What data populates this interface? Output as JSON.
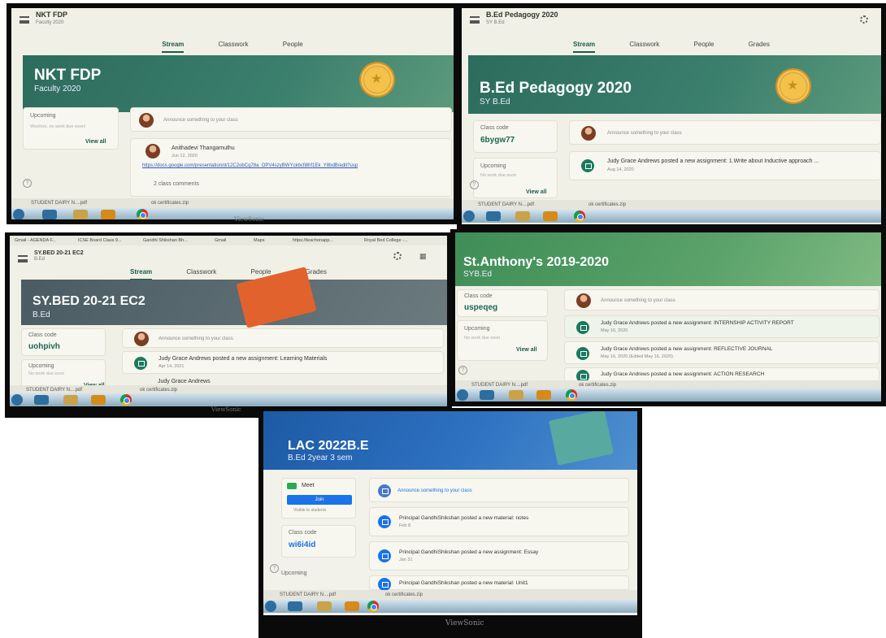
{
  "tabs": {
    "stream": "Stream",
    "classwork": "Classwork",
    "people": "People",
    "grades": "Grades"
  },
  "common": {
    "announce": "Announce something to your class",
    "upcoming": "Upcoming",
    "no_work": "Woohoo, no work due soon!",
    "no_work_short": "No work due soon",
    "view_all": "View all",
    "class_code": "Class code",
    "dl_pdf": "STUDENT DAIRY N....pdf",
    "dl_zip": "ok certificates.zip",
    "brand": "ViewSonic"
  },
  "p1": {
    "title": "NKT FDP",
    "sub": "Faculty 2020",
    "author": "Anithadevi Thangamuthu",
    "date": "Jun 12, 2020",
    "link": "https://docs.google.com/presentation/d/12C2obCq78a_OPV4szyBWYckbcfi8hf1Ek_Y8bdB/edit?usp",
    "comments": "2 class comments"
  },
  "p2": {
    "title": "B.Ed Pedagogy 2020",
    "sub": "SY B.Ed",
    "code": "6bygw77",
    "post": "Judy Grace Andrews posted a new assignment: 1.Write about Inductive approach ...",
    "date": "Aug 14, 2020"
  },
  "p3": {
    "title": "SY.BED 20-21 EC2",
    "sub": "B.Ed",
    "code": "uohpivh",
    "post": "Judy Grace Andrews posted a new assignment: Learning Materials",
    "date": "Apr 14, 2021",
    "post2": "Judy Grace Andrews",
    "bookmarks": [
      "Gmail - AGENDA F...",
      "ICSE Board Class 9...",
      "Gandhi Shikshan Bh...",
      "Gmail",
      "Maps",
      "https://teachonapp...",
      "Royal Bed College -..."
    ]
  },
  "p4": {
    "title": "St.Anthony's 2019-2020",
    "sub": "SYB.Ed",
    "code": "uspeqeg",
    "post1": "Judy Grace Andrews posted a new assignment: INTERNSHIP ACTIVITY REPORT",
    "date1": "May 16, 2020",
    "post2": "Judy Grace Andrews posted a new assignment: REFLECTIVE JOURNAL",
    "date2": "May 16, 2020 (Edited May 16, 2020)",
    "post3": "Judy Grace Andrews posted a new assignment: ACTION RESEARCH"
  },
  "p5": {
    "title": "LAC 2022B.E",
    "sub": "B.Ed 2year 3 sem",
    "meet": "Meet",
    "join": "Join",
    "visible": "Visible to students",
    "code": "wi6i4id",
    "post1": "Principal GandhiShikshan posted a new material: notes",
    "date1": "Feb 8",
    "post2": "Principal GandhiShikshan posted a new assignment: Essay",
    "date2": "Jan 31",
    "post3": "Principal GandhiShikshan posted a new material: Unit1"
  }
}
